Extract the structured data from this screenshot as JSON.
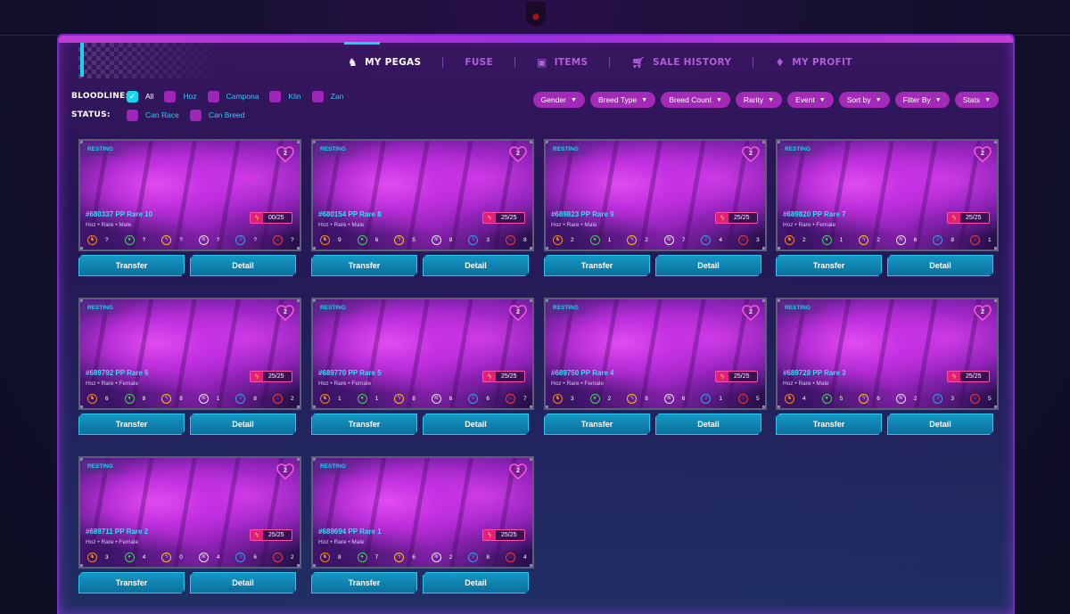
{
  "nav": [
    {
      "label": "MY PEGAS",
      "icon": "horse-icon",
      "active": true
    },
    {
      "label": "FUSE",
      "icon": "",
      "active": false
    },
    {
      "label": "ITEMS",
      "icon": "chest-icon",
      "active": false
    },
    {
      "label": "SALE HISTORY",
      "icon": "cart-icon",
      "active": false
    },
    {
      "label": "MY PROFIT",
      "icon": "bag-icon",
      "active": false
    }
  ],
  "filters": {
    "bloodline_label": "BLOODLINE:",
    "status_label": "STATUS:",
    "bloodline_options": [
      {
        "label": "All",
        "checked": true
      },
      {
        "label": "Hoz",
        "checked": false
      },
      {
        "label": "Campona",
        "checked": false
      },
      {
        "label": "Klin",
        "checked": false
      },
      {
        "label": "Zan",
        "checked": false
      }
    ],
    "status_options": [
      {
        "label": "Can Race",
        "checked": false
      },
      {
        "label": "Can Breed",
        "checked": false
      }
    ]
  },
  "dropdowns": [
    "Gender",
    "Breed Type",
    "Breed Count",
    "Rarity",
    "Event",
    "Sort by",
    "Filter By",
    "Stats"
  ],
  "buttons": {
    "transfer": "Transfer",
    "detail": "Detail"
  },
  "stat_icons": [
    {
      "name": "speed-icon",
      "color": "#f08a1a",
      "glyph": "♞"
    },
    {
      "name": "strength-icon",
      "color": "#3ed35a",
      "glyph": "●"
    },
    {
      "name": "lightning-icon",
      "color": "#f5c518",
      "glyph": "ϟ"
    },
    {
      "name": "wind-icon",
      "color": "#e8e8f0",
      "glyph": "≋"
    },
    {
      "name": "water-icon",
      "color": "#3a9cf0",
      "glyph": "≡"
    },
    {
      "name": "fire-icon",
      "color": "#f03a3a",
      "glyph": "♨"
    }
  ],
  "cards": [
    {
      "status": "RESTING",
      "heart": "2",
      "name": "#680337 PP Rare 10",
      "meta": "Hoz • Rare • Male",
      "energy": "00/25",
      "stats": [
        "?",
        "?",
        "?",
        "?",
        "?",
        "?"
      ]
    },
    {
      "status": "RESTING",
      "heart": "2",
      "name": "#680154 PP Rare 8",
      "meta": "Hoz • Rare • Male",
      "energy": "25/25",
      "stats": [
        "9",
        "6",
        "5",
        "8",
        "3",
        "8"
      ]
    },
    {
      "status": "RESTING",
      "heart": "2",
      "name": "#689823 PP Rare 9",
      "meta": "Hoz • Rare • Male",
      "energy": "25/25",
      "stats": [
        "2",
        "1",
        "2",
        "7",
        "4",
        "3"
      ]
    },
    {
      "status": "RESTING",
      "heart": "2",
      "name": "#689820 PP Rare 7",
      "meta": "Hoz • Rare • Female",
      "energy": "25/25",
      "stats": [
        "2",
        "1",
        "2",
        "6",
        "8",
        "1"
      ]
    },
    {
      "status": "RESTING",
      "heart": "2",
      "name": "#689792 PP Rare 6",
      "meta": "Hoz • Rare • Female",
      "energy": "25/25",
      "stats": [
        "6",
        "8",
        "8",
        "1",
        "8",
        "2"
      ]
    },
    {
      "status": "RESTING",
      "heart": "2",
      "name": "#689770 PP Rare 5",
      "meta": "Hoz • Rare • Female",
      "energy": "25/25",
      "stats": [
        "1",
        "1",
        "8",
        "6",
        "6",
        "7"
      ]
    },
    {
      "status": "RESTING",
      "heart": "2",
      "name": "#689750 PP Rare 4",
      "meta": "Hoz • Rare • Female",
      "energy": "25/25",
      "stats": [
        "3",
        "2",
        "8",
        "6",
        "1",
        "5"
      ]
    },
    {
      "status": "RESTING",
      "heart": "2",
      "name": "#689728 PP Rare 3",
      "meta": "Hoz • Rare • Male",
      "energy": "25/25",
      "stats": [
        "4",
        "5",
        "6",
        "2",
        "3",
        "5"
      ]
    },
    {
      "status": "RESTING",
      "heart": "2",
      "name": "#689711 PP Rare 2",
      "meta": "Hoz • Rare • Female",
      "energy": "25/25",
      "stats": [
        "3",
        "4",
        "0",
        "4",
        "6",
        "2"
      ]
    },
    {
      "status": "RESTING",
      "heart": "2",
      "name": "#689694 PP Rare 1",
      "meta": "Hoz • Rare • Male",
      "energy": "25/25",
      "stats": [
        "8",
        "7",
        "6",
        "2",
        "8",
        "4"
      ]
    }
  ]
}
